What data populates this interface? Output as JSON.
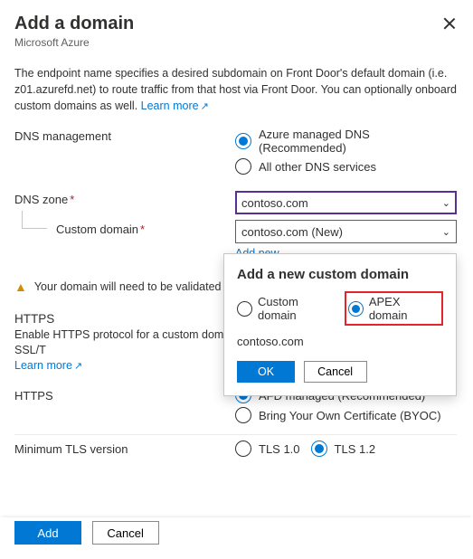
{
  "header": {
    "title": "Add a domain",
    "subtitle": "Microsoft Azure"
  },
  "intro": {
    "text": "The endpoint name specifies a desired subdomain on Front Door's default domain (i.e. z01.azurefd.net) to route traffic from that host via Front Door. You can optionally onboard custom domains as well.",
    "learn": "Learn more"
  },
  "dns_mgmt": {
    "label": "DNS management",
    "opt1": "Azure managed DNS (Recommended)",
    "opt2": "All other DNS services"
  },
  "dns_zone": {
    "label": "DNS zone",
    "value": "contoso.com"
  },
  "custom_domain": {
    "label": "Custom domain",
    "value": "contoso.com (New)",
    "add_new": "Add new"
  },
  "warning": "Your domain will need to be validated befo",
  "https_section": {
    "title": "HTTPS",
    "desc": "Enable HTTPS protocol for a custom domain sensitive data is delivered securely via SSL/T",
    "learn": "Learn more"
  },
  "https_mode": {
    "label": "HTTPS",
    "opt1": "AFD managed (Recommended)",
    "opt2": "Bring Your Own Certificate (BYOC)"
  },
  "tls": {
    "label": "Minimum TLS version",
    "opt1": "TLS 1.0",
    "opt2": "TLS 1.2"
  },
  "footer": {
    "add": "Add",
    "cancel": "Cancel"
  },
  "popup": {
    "title": "Add a new custom domain",
    "opt1": "Custom domain",
    "opt2": "APEX domain",
    "domain": "contoso.com",
    "ok": "OK",
    "cancel": "Cancel"
  }
}
